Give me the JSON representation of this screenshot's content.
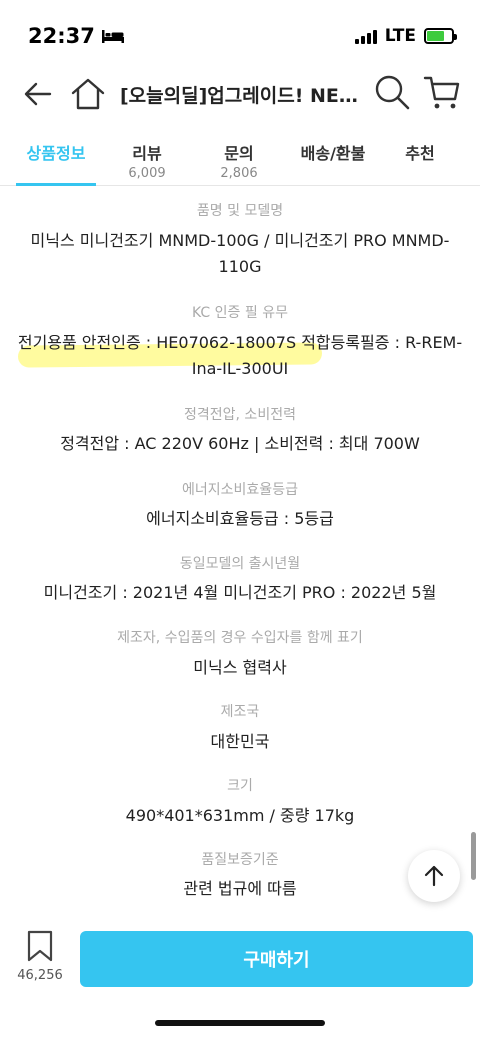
{
  "status_bar": {
    "time": "22:37",
    "network": "LTE",
    "battery_level": 0.7
  },
  "header": {
    "title": "[오늘의딜]업그레이드! NEW..."
  },
  "tabs": [
    {
      "label": "상품정보",
      "count": ""
    },
    {
      "label": "리뷰",
      "count": "6,009"
    },
    {
      "label": "문의",
      "count": "2,806"
    },
    {
      "label": "배송/환불",
      "count": ""
    },
    {
      "label": "추천",
      "count": ""
    }
  ],
  "specs": [
    {
      "label": "품명 및 모델명",
      "value": "미닉스 미니건조기 MNMD-100G / 미니건조기 PRO MNMD-110G"
    },
    {
      "label": "KC 인증 필 유무",
      "value": "전기용품 안전인증 : HE07062-18007S  적합등록필증 : R-REM-Ina-IL-300UI"
    },
    {
      "label": "정격전압, 소비전력",
      "value": "정격전압 : AC 220V 60Hz | 소비전력 : 최대 700W"
    },
    {
      "label": "에너지소비효율등급",
      "value": "에너지소비효율등급 : 5등급"
    },
    {
      "label": "동일모델의 출시년월",
      "value": "미니건조기 : 2021년 4월 미니건조기 PRO : 2022년 5월"
    },
    {
      "label": "제조자, 수입품의 경우 수입자를 함께 표기",
      "value": "미닉스 협력사"
    },
    {
      "label": "제조국",
      "value": "대한민국"
    },
    {
      "label": "크기",
      "value": "490*401*631mm / 중량 17kg"
    },
    {
      "label": "품질보증기준",
      "value": "관련 법규에 따름"
    }
  ],
  "bottom_bar": {
    "bookmark_count": "46,256",
    "buy_label": "구매하기"
  },
  "colors": {
    "accent": "#35c5f0",
    "highlight": "#fff750"
  }
}
